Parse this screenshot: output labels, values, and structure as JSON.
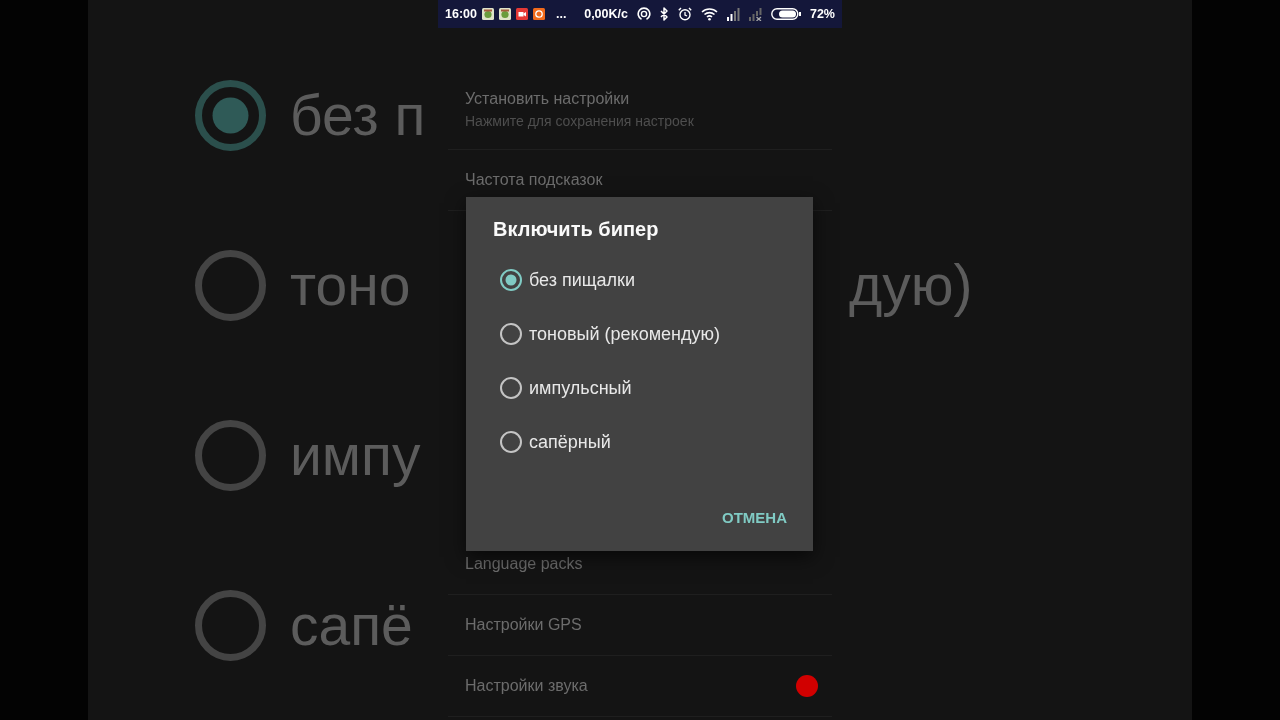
{
  "status_bar": {
    "time": "16:00",
    "more": "...",
    "speed": "0,00K/c",
    "battery": "72%"
  },
  "backdrop": {
    "left_rows": [
      {
        "text": "без п",
        "selected": true
      },
      {
        "text": "тоно",
        "selected": false
      },
      {
        "text": "импу",
        "selected": false
      },
      {
        "text": "сапё",
        "selected": false
      }
    ],
    "right_text": "дую)"
  },
  "settings_above_dialog": [
    {
      "title": "Установить настройки",
      "subtitle": "Нажмите для сохранения настроек",
      "badge_dot": false
    },
    {
      "title": "Частота подсказок",
      "badge_dot": false
    }
  ],
  "settings_below_dialog": [
    {
      "title": "Language packs",
      "badge_dot": false
    },
    {
      "title": "Настройки GPS",
      "badge_dot": false
    },
    {
      "title": "Настройки звука",
      "badge_dot": true
    }
  ],
  "dialog": {
    "title": "Включить бипер",
    "options": [
      {
        "label": "без пищалки",
        "selected": true
      },
      {
        "label": "тоновый (рекомендую)",
        "selected": false
      },
      {
        "label": "импульсный",
        "selected": false
      },
      {
        "label": "сапёрный",
        "selected": false
      }
    ],
    "buttons": [
      "ОТМЕНА"
    ]
  }
}
